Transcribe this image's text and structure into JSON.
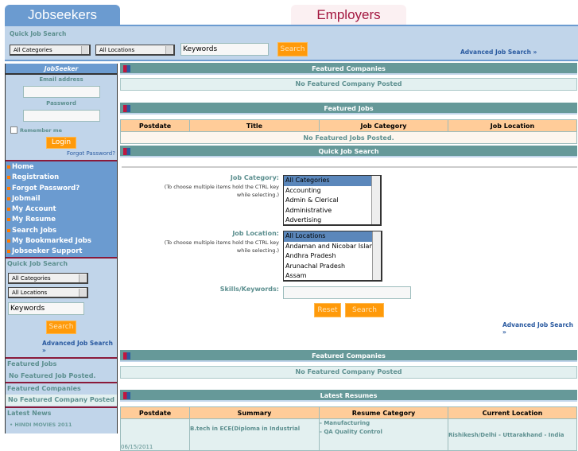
{
  "tabs": {
    "jobseekers": "Jobseekers",
    "employers": "Employers"
  },
  "topbar": {
    "title": "Quick Job Search",
    "category": "All Categories",
    "location": "All Locations",
    "keywords": "Keywords",
    "search": "Search",
    "advanced": "Advanced Job Search »"
  },
  "sidebar": {
    "login": {
      "title": "JobSeeker",
      "email_label": "Email address",
      "password_label": "Password",
      "remember": "Remember me",
      "login": "Login",
      "forgot": "Forgot Password?"
    },
    "nav": [
      "Home",
      "Registration",
      "Forgot Password?",
      "Jobmail",
      "My Account",
      "My Resume",
      "Search Jobs",
      "My Bookmarked Jobs",
      "Jobseeker Support"
    ],
    "quick": {
      "title": "Quick Job Search",
      "category": "All Categories",
      "location": "All Locations",
      "keywords": "Keywords",
      "search": "Search",
      "advanced": "Advanced Job Search »"
    },
    "featured_jobs": {
      "title": "Featured Jobs",
      "msg": "No Featured Job Posted."
    },
    "featured_companies": {
      "title": "Featured Companies",
      "msg": "No Featured Company Posted"
    },
    "news": {
      "title": "Latest News",
      "items": [
        "HINDI MOVIES 2011"
      ]
    }
  },
  "main": {
    "featured_companies": {
      "title": "Featured Companies",
      "msg": "No Featured Company Posted"
    },
    "featured_jobs": {
      "title": "Featured Jobs",
      "columns": [
        "Postdate",
        "Title",
        "Job Category",
        "Job Location"
      ],
      "msg": "No Featured Jobs Posted."
    },
    "quick_search": {
      "title": "Quick Job Search",
      "category_label": "Job Category:",
      "help": "(To choose multiple items hold the CTRL key while selecting.)",
      "categories": [
        "All Categories",
        "Accounting",
        "Admin & Clerical",
        "Administrative",
        "Advertising"
      ],
      "location_label": "Job Location:",
      "locations": [
        "All Locations",
        "Andaman and Nicobar Islands",
        "Andhra Pradesh",
        "Arunachal Pradesh",
        "Assam"
      ],
      "skills_label": "Skills/Keywords:",
      "skills_value": "",
      "reset": "Reset",
      "search": "Search",
      "advanced": "Advanced Job Search »"
    },
    "featured_companies2": {
      "title": "Featured Companies",
      "msg": "No Featured Company Posted"
    },
    "resumes": {
      "title": "Latest Resumes",
      "columns": [
        "Postdate",
        "Summary",
        "Resume Category",
        "Current Location"
      ],
      "rows": [
        {
          "postdate": "06/15/2011",
          "summary": "B.tech in ECE(Diploma in Industrial",
          "category": [
            "- Manufacturing",
            "- QA Quality Control"
          ],
          "location": "Rishikesh/Delhi - Uttarakhand - India"
        }
      ]
    }
  }
}
